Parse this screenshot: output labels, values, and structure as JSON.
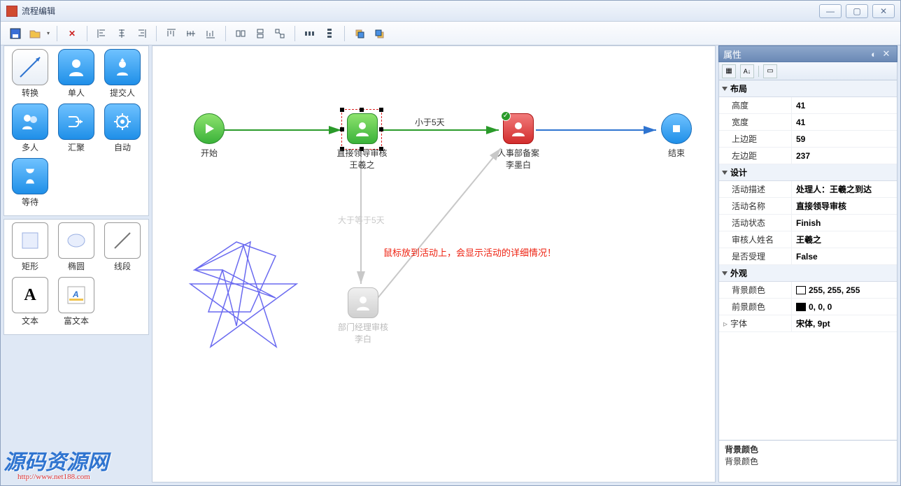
{
  "window": {
    "title": "流程编辑"
  },
  "palette": {
    "tools": [
      {
        "label": "转换",
        "icon": "arrow"
      },
      {
        "label": "单人",
        "icon": "person"
      },
      {
        "label": "提交人",
        "icon": "person-up"
      },
      {
        "label": "多人",
        "icon": "people"
      },
      {
        "label": "汇聚",
        "icon": "merge"
      },
      {
        "label": "自动",
        "icon": "gear"
      },
      {
        "label": "等待",
        "icon": "hourglass"
      }
    ],
    "shapes": [
      {
        "label": "矩形",
        "icon": "rect"
      },
      {
        "label": "椭圆",
        "icon": "ellipse"
      },
      {
        "label": "线段",
        "icon": "line"
      },
      {
        "label": "文本",
        "icon": "text"
      },
      {
        "label": "富文本",
        "icon": "richtext"
      }
    ]
  },
  "canvas": {
    "nodes": {
      "start": {
        "label": "开始"
      },
      "leader": {
        "label1": "直接领导审核",
        "label2": "王羲之"
      },
      "hr": {
        "label1": "人事部备案",
        "label2": "李墨白"
      },
      "end": {
        "label": "结束"
      },
      "dept": {
        "label1": "部门经理审核",
        "label2": "李白"
      }
    },
    "edges": {
      "lt5": "小于5天",
      "gte5": "大于等于5天"
    },
    "hint": "鼠标放到活动上，会显示活动的详细情况！"
  },
  "props": {
    "title": "属性",
    "categories": {
      "layout": {
        "name": "布局",
        "rows": [
          {
            "name": "高度",
            "value": "41"
          },
          {
            "name": "宽度",
            "value": "41"
          },
          {
            "name": "上边距",
            "value": "59"
          },
          {
            "name": "左边距",
            "value": "237"
          }
        ]
      },
      "design": {
        "name": "设计",
        "rows": [
          {
            "name": "活动描述",
            "value": "处理人：王羲之到达"
          },
          {
            "name": "活动名称",
            "value": "直接领导审核"
          },
          {
            "name": "活动状态",
            "value": "Finish"
          },
          {
            "name": "审核人姓名",
            "value": "王羲之"
          },
          {
            "name": "是否受理",
            "value": "False"
          }
        ]
      },
      "appearance": {
        "name": "外观",
        "rows": [
          {
            "name": "背景颜色",
            "value": "255, 255, 255",
            "swatch": "#ffffff"
          },
          {
            "name": "前景颜色",
            "value": "0, 0, 0",
            "swatch": "#000000"
          },
          {
            "name": "字体",
            "value": "宋体, 9pt"
          }
        ]
      }
    },
    "desc": {
      "title": "背景颜色",
      "body": "背景颜色"
    }
  },
  "watermark": {
    "text": "源码资源网",
    "url": "http://www.net188.com"
  }
}
